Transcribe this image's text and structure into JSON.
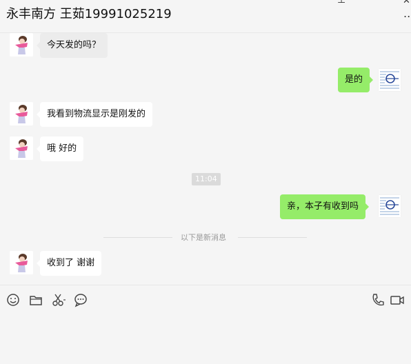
{
  "header": {
    "title": "永丰南方 王茹19991025219",
    "more_label": "..."
  },
  "messages": [
    {
      "side": "in",
      "text": "今天发的吗？"
    },
    {
      "side": "out",
      "text": "是的"
    },
    {
      "side": "in",
      "text": "我看到物流显示是刚发的"
    },
    {
      "side": "in",
      "text": "哦  好的"
    },
    {
      "side": "out",
      "text": "亲，本子有收到吗"
    },
    {
      "side": "in",
      "text": "收到了  谢谢"
    }
  ],
  "time_badge": "11:04",
  "divider_text": "以下是新消息",
  "toolbar": {
    "icons": [
      "emoji-icon",
      "folder-icon",
      "scissors-icon",
      "chat-bubble-icon",
      "phone-icon",
      "video-icon"
    ]
  },
  "input": {
    "value": ""
  }
}
